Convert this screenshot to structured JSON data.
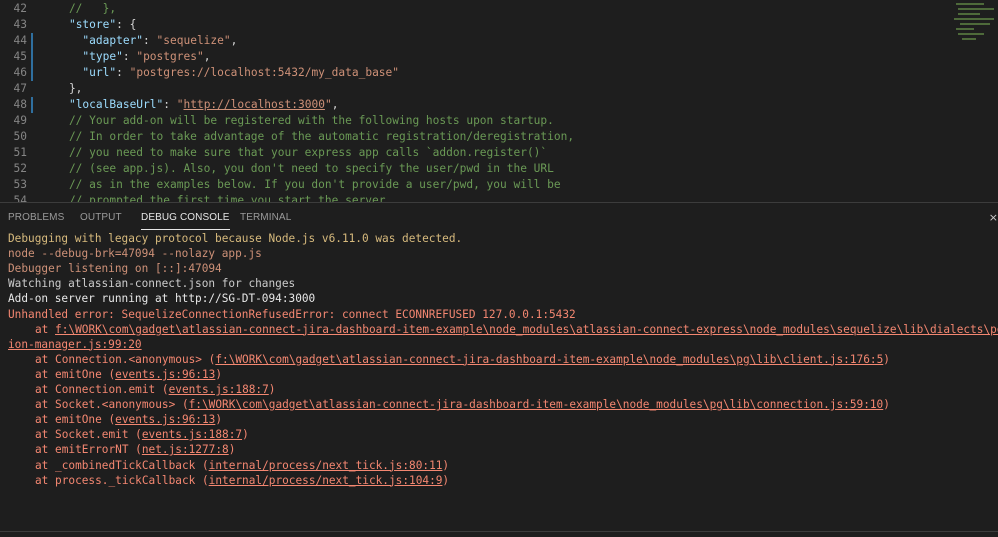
{
  "editor": {
    "lines": [
      {
        "num": "42",
        "parts": [
          {
            "t": "    //   },",
            "c": "c"
          }
        ]
      },
      {
        "num": "43",
        "parts": [
          {
            "t": "    ",
            "c": "p"
          },
          {
            "t": "\"store\"",
            "c": "k"
          },
          {
            "t": ": {",
            "c": "p"
          }
        ]
      },
      {
        "num": "44",
        "mark": true,
        "parts": [
          {
            "t": "      ",
            "c": "p"
          },
          {
            "t": "\"adapter\"",
            "c": "k"
          },
          {
            "t": ": ",
            "c": "p"
          },
          {
            "t": "\"sequelize\"",
            "c": "s"
          },
          {
            "t": ",",
            "c": "p"
          }
        ]
      },
      {
        "num": "45",
        "mark": true,
        "parts": [
          {
            "t": "      ",
            "c": "p"
          },
          {
            "t": "\"type\"",
            "c": "k"
          },
          {
            "t": ": ",
            "c": "p"
          },
          {
            "t": "\"postgres\"",
            "c": "s"
          },
          {
            "t": ",",
            "c": "p"
          }
        ]
      },
      {
        "num": "46",
        "mark": true,
        "parts": [
          {
            "t": "      ",
            "c": "p"
          },
          {
            "t": "\"url\"",
            "c": "k"
          },
          {
            "t": ": ",
            "c": "p"
          },
          {
            "t": "\"postgres://localhost:5432/my_data_base\"",
            "c": "s"
          }
        ]
      },
      {
        "num": "47",
        "parts": [
          {
            "t": "    },",
            "c": "p"
          }
        ]
      },
      {
        "num": "48",
        "mark": true,
        "parts": [
          {
            "t": "    ",
            "c": "p"
          },
          {
            "t": "\"localBaseUrl\"",
            "c": "k"
          },
          {
            "t": ": ",
            "c": "p"
          },
          {
            "t": "\"",
            "c": "s"
          },
          {
            "t": "http://localhost:3000",
            "c": "u"
          },
          {
            "t": "\"",
            "c": "s"
          },
          {
            "t": ",",
            "c": "p"
          }
        ]
      },
      {
        "num": "49",
        "parts": [
          {
            "t": "    // Your add-on will be registered with the following hosts upon startup.",
            "c": "c"
          }
        ]
      },
      {
        "num": "50",
        "parts": [
          {
            "t": "    // In order to take advantage of the automatic registration/deregistration,",
            "c": "c"
          }
        ]
      },
      {
        "num": "51",
        "parts": [
          {
            "t": "    // you need to make sure that your express app calls `addon.register()`",
            "c": "c"
          }
        ]
      },
      {
        "num": "52",
        "parts": [
          {
            "t": "    // (see app.js). Also, you don't need to specify the user/pwd in the URL",
            "c": "c"
          }
        ]
      },
      {
        "num": "53",
        "parts": [
          {
            "t": "    // as in the examples below. If you don't provide a user/pwd, you will be",
            "c": "c"
          }
        ]
      },
      {
        "num": "54",
        "parts": [
          {
            "t": "    // prompted the first time you start the server.",
            "c": "c"
          }
        ]
      }
    ]
  },
  "panel": {
    "tabs": [
      {
        "label": "PROBLEMS",
        "active": false
      },
      {
        "label": "OUTPUT",
        "active": false
      },
      {
        "label": "DEBUG CONSOLE",
        "active": true
      },
      {
        "label": "TERMINAL",
        "active": false
      }
    ],
    "close_glyph": "×",
    "console": [
      {
        "cls": "yellow",
        "parts": [
          {
            "t": "Debugging with legacy protocol because Node.js v6.11.0 was detected."
          }
        ]
      },
      {
        "cls": "orange",
        "parts": [
          {
            "t": "node --debug-brk=47094 --nolazy app.js"
          }
        ]
      },
      {
        "cls": "orange",
        "parts": [
          {
            "t": "Debugger listening on [::]:47094"
          }
        ]
      },
      {
        "cls": "white",
        "parts": [
          {
            "t": "Watching atlassian-connect.json for changes"
          }
        ]
      },
      {
        "cls": "bright",
        "parts": [
          {
            "t": "Add-on server running at http://SG-DT-094:3000"
          }
        ]
      },
      {
        "cls": "red",
        "parts": [
          {
            "t": "Unhandled error: SequelizeConnectionRefusedError: connect ECONNREFUSED 127.0.0.1:5432"
          }
        ]
      },
      {
        "cls": "red",
        "indent": true,
        "parts": [
          {
            "t": "at "
          },
          {
            "t": "f:\\WORK\\com\\gadget\\atlassian-connect-jira-dashboard-item-example\\node_modules\\atlassian-connect-express\\node_modules\\sequelize\\lib\\dialects\\postgres\\connect",
            "link": true
          }
        ]
      },
      {
        "cls": "red",
        "parts": [
          {
            "t": "ion-manager.js:99:20",
            "link": true
          }
        ]
      },
      {
        "cls": "red",
        "indent": true,
        "parts": [
          {
            "t": "at Connection.<anonymous> ("
          },
          {
            "t": "f:\\WORK\\com\\gadget\\atlassian-connect-jira-dashboard-item-example\\node_modules\\pg\\lib\\client.js:176:5",
            "link": true
          },
          {
            "t": ")"
          }
        ]
      },
      {
        "cls": "red",
        "indent": true,
        "parts": [
          {
            "t": "at emitOne ("
          },
          {
            "t": "events.js:96:13",
            "link": true
          },
          {
            "t": ")"
          }
        ]
      },
      {
        "cls": "red",
        "indent": true,
        "parts": [
          {
            "t": "at Connection.emit ("
          },
          {
            "t": "events.js:188:7",
            "link": true
          },
          {
            "t": ")"
          }
        ]
      },
      {
        "cls": "red",
        "indent": true,
        "parts": [
          {
            "t": "at Socket.<anonymous> ("
          },
          {
            "t": "f:\\WORK\\com\\gadget\\atlassian-connect-jira-dashboard-item-example\\node_modules\\pg\\lib\\connection.js:59:10",
            "link": true
          },
          {
            "t": ")"
          }
        ]
      },
      {
        "cls": "red",
        "indent": true,
        "parts": [
          {
            "t": "at emitOne ("
          },
          {
            "t": "events.js:96:13",
            "link": true
          },
          {
            "t": ")"
          }
        ]
      },
      {
        "cls": "red",
        "indent": true,
        "parts": [
          {
            "t": "at Socket.emit ("
          },
          {
            "t": "events.js:188:7",
            "link": true
          },
          {
            "t": ")"
          }
        ]
      },
      {
        "cls": "red",
        "indent": true,
        "parts": [
          {
            "t": "at emitErrorNT ("
          },
          {
            "t": "net.js:1277:8",
            "link": true
          },
          {
            "t": ")"
          }
        ]
      },
      {
        "cls": "red",
        "indent": true,
        "parts": [
          {
            "t": "at _combinedTickCallback ("
          },
          {
            "t": "internal/process/next_tick.js:80:11",
            "link": true
          },
          {
            "t": ")"
          }
        ]
      },
      {
        "cls": "red",
        "indent": true,
        "parts": [
          {
            "t": "at process._tickCallback ("
          },
          {
            "t": "internal/process/next_tick.js:104:9",
            "link": true
          },
          {
            "t": ")"
          }
        ]
      }
    ]
  }
}
